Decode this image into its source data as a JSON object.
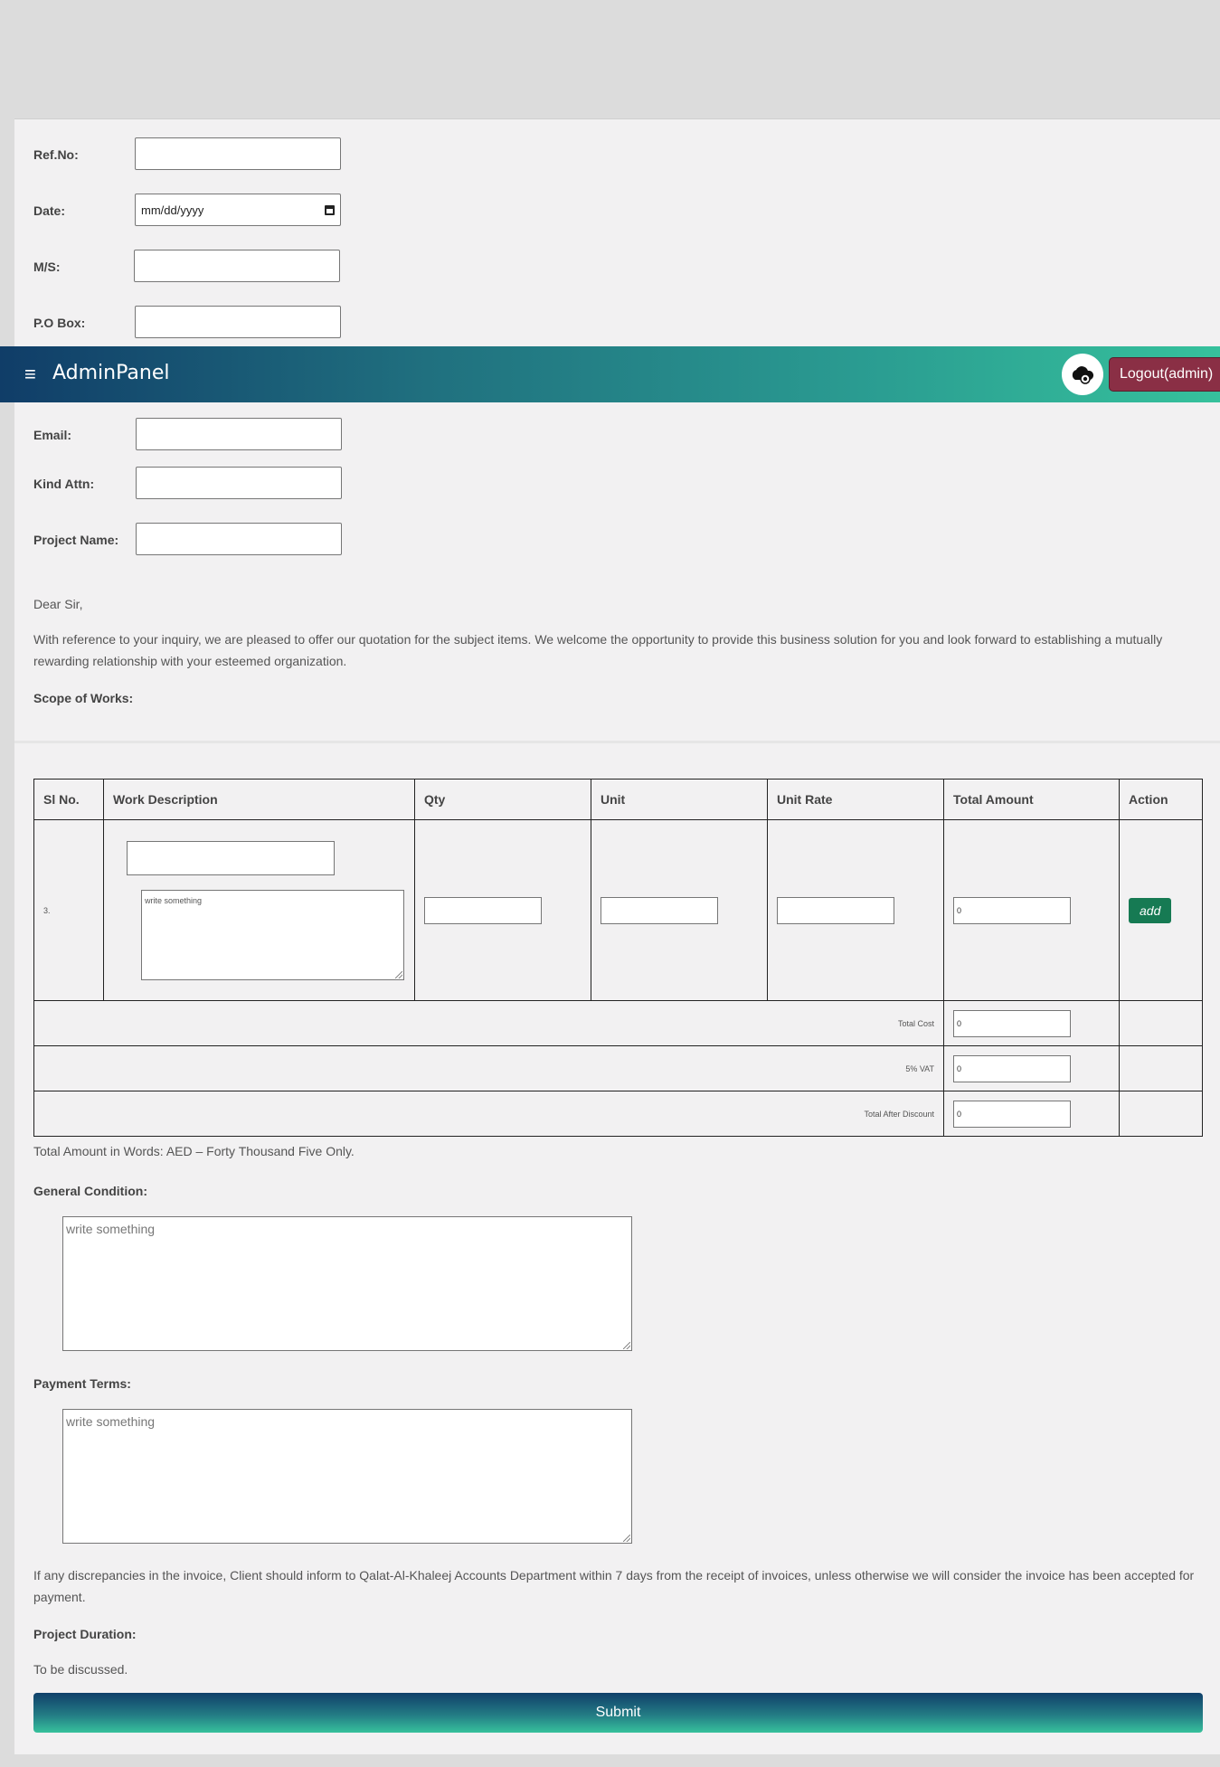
{
  "navbar": {
    "menu_icon": "hamburger-icon",
    "brand": "AdminPanel",
    "avatar_icon": "cloud-eye-icon",
    "logout_label": "Logout(admin)"
  },
  "form": {
    "ref_no_label": "Ref.No:",
    "date_label": "Date:",
    "date_placeholder": "mm/dd/yyyy",
    "ms_label": "M/S:",
    "po_box_label": "P.O Box:",
    "email_label": "Email:",
    "kind_attn_label": "Kind Attn:",
    "project_name_label": "Project Name:"
  },
  "letter": {
    "salutation": "Dear Sir,",
    "body": "With reference to your inquiry, we are pleased to offer our quotation for the subject items. We welcome the opportunity to provide this business solution for you and look forward to establishing a mutually rewarding relationship with your esteemed organization.",
    "scope_heading": "Scope of Works:"
  },
  "table": {
    "headers": [
      "Sl No.",
      "Work Description",
      "Qty",
      "Unit",
      "Unit Rate",
      "Total Amount",
      "Action"
    ],
    "row": {
      "sl_no": "3.",
      "desc_placeholder": "write something",
      "total_amount": "0",
      "action_label": "add"
    },
    "totals": [
      {
        "label": "Total Cost",
        "value": "0"
      },
      {
        "label": "5% VAT",
        "value": "0"
      },
      {
        "label": "Total After Discount",
        "value": "0"
      }
    ]
  },
  "amount_in_words": "Total Amount in Words: AED – Forty Thousand Five Only.",
  "general_condition": {
    "heading": "General Condition:",
    "placeholder": "write something"
  },
  "payment_terms": {
    "heading": "Payment Terms:",
    "placeholder": "write something"
  },
  "discrepancy_note": "If any discrepancies in the invoice, Client should inform to Qalat-Al-Khaleej Accounts Department within 7 days from the receipt of invoices, unless otherwise we will consider the invoice has been accepted for payment.",
  "project_duration": {
    "heading": "Project Duration:",
    "text": "To be discussed."
  },
  "submit_label": "Submit"
}
